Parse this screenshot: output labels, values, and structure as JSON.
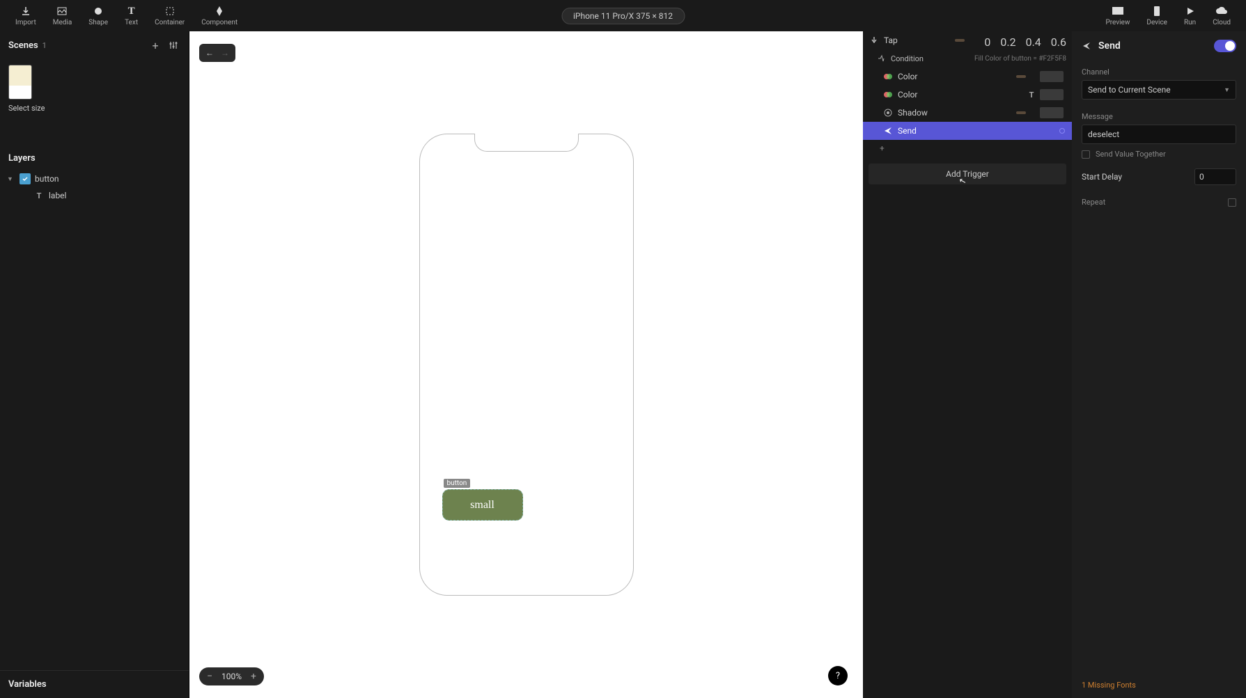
{
  "toolbar": {
    "import": "Import",
    "media": "Media",
    "shape": "Shape",
    "text": "Text",
    "container": "Container",
    "component": "Component",
    "device_label": "iPhone 11 Pro/X  375 × 812",
    "preview": "Preview",
    "device": "Device",
    "run": "Run",
    "cloud": "Cloud"
  },
  "scenes": {
    "title": "Scenes",
    "count": "1",
    "caption": "Select size"
  },
  "layers": {
    "title": "Layers",
    "button": "button",
    "label": "label"
  },
  "variables": {
    "title": "Variables"
  },
  "canvas": {
    "component_label": "button",
    "button_text": "small",
    "zoom": "100%",
    "help": "?"
  },
  "triggers": {
    "tap": "Tap",
    "condition": "Condition",
    "condition_hint": "Fill Color of button = #F2F5F8",
    "color1": "Color",
    "color2": "Color",
    "shadow": "Shadow",
    "send": "Send",
    "add": "+",
    "add_trigger": "Add Trigger",
    "ticks": {
      "t0": "0",
      "t1": "0.2",
      "t2": "0.4",
      "t3": "0.6"
    }
  },
  "inspector": {
    "title": "Send",
    "channel_label": "Channel",
    "channel_value": "Send to Current Scene",
    "message_label": "Message",
    "message_value": "deselect",
    "send_value_together": "Send Value Together",
    "start_delay_label": "Start Delay",
    "start_delay_value": "0",
    "repeat_label": "Repeat",
    "missing_fonts": "1 Missing Fonts"
  }
}
